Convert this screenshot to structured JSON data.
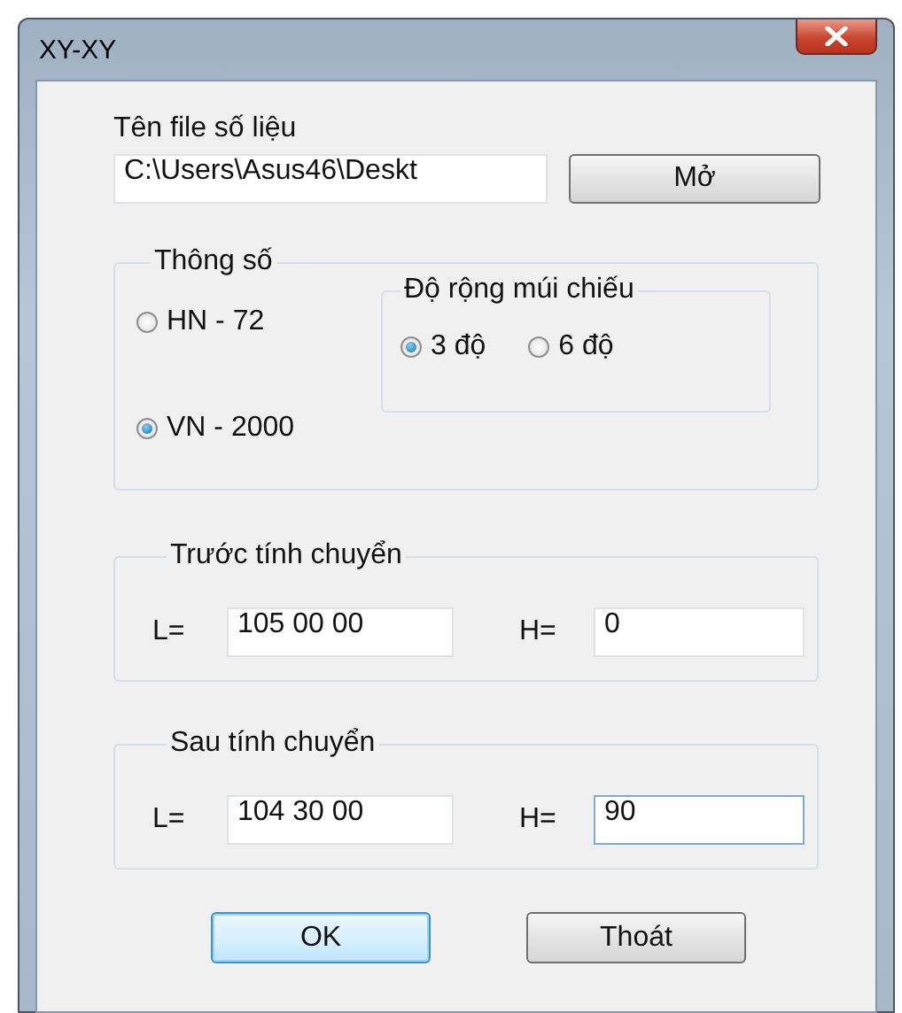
{
  "window": {
    "title": "XY-XY"
  },
  "file": {
    "label": "Tên file số liệu",
    "value": "C:\\Users\\Asus46\\Deskt",
    "button": "Mở"
  },
  "parameters": {
    "title": "Thông số",
    "datums": [
      {
        "label": "HN - 72",
        "selected": false
      },
      {
        "label": "VN - 2000",
        "selected": true
      }
    ],
    "zone_width": {
      "title": "Độ rộng múi chiếu",
      "options": [
        {
          "label": "3 độ",
          "selected": true
        },
        {
          "label": "6 độ",
          "selected": false
        }
      ]
    }
  },
  "groups": [
    {
      "title": "Trước tính chuyển",
      "fields": [
        {
          "label": "L=",
          "value": "105 00 00",
          "focused": false
        },
        {
          "label": "H=",
          "value": "0",
          "focused": false
        }
      ]
    },
    {
      "title": "Sau tính chuyển",
      "fields": [
        {
          "label": "L=",
          "value": "104 30 00",
          "focused": false
        },
        {
          "label": "H=",
          "value": "90",
          "focused": true
        }
      ]
    }
  ],
  "buttons": [
    {
      "label": "OK",
      "default": true
    },
    {
      "label": "Thoát",
      "default": false
    }
  ]
}
